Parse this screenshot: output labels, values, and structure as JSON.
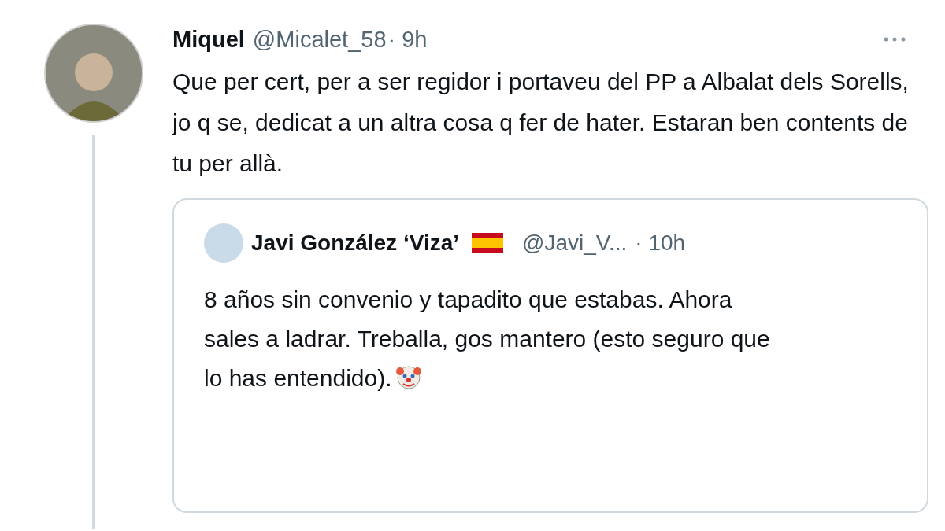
{
  "tweet": {
    "name": "Miquel",
    "handle": "@Micalet_58",
    "time": "· 9h",
    "text": "Que per cert, per a ser regidor i portaveu del PP a Albalat dels Sorells, jo q se, dedicat a un altra cosa q fer de hater. Estaran ben contents de tu per allà.",
    "quote": {
      "name": "Javi González ‘Viza’",
      "handle": "@Javi_V...",
      "time": "· 10h",
      "text": "8 años sin convenio y tapadito que estabas. Ahora sales a ladrar. Treballa, gos mantero (esto seguro que lo has entendido)."
    }
  }
}
